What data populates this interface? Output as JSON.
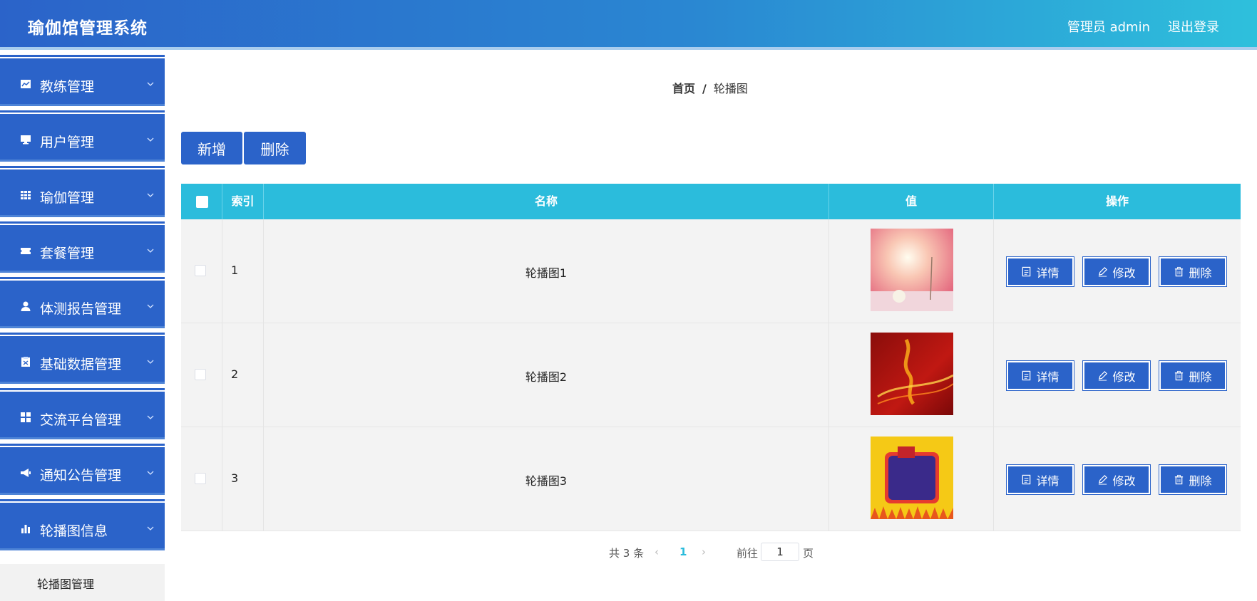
{
  "header": {
    "title": "瑜伽馆管理系统",
    "user": "管理员 admin",
    "logout": "退出登录"
  },
  "sidebar": {
    "items": [
      {
        "label": "教练管理",
        "icon": "chart-icon"
      },
      {
        "label": "用户管理",
        "icon": "monitor-icon"
      },
      {
        "label": "瑜伽管理",
        "icon": "grid-icon"
      },
      {
        "label": "套餐管理",
        "icon": "ticket-icon"
      },
      {
        "label": "体测报告管理",
        "icon": "user-icon"
      },
      {
        "label": "基础数据管理",
        "icon": "clipboard-icon"
      },
      {
        "label": "交流平台管理",
        "icon": "apps-icon"
      },
      {
        "label": "通知公告管理",
        "icon": "megaphone-icon"
      },
      {
        "label": "轮播图信息",
        "icon": "bar-chart-icon"
      }
    ],
    "submenu": {
      "label": "轮播图管理"
    }
  },
  "breadcrumb": {
    "home": "首页",
    "separator": "/",
    "current": "轮播图"
  },
  "toolbar": {
    "add_label": "新增",
    "delete_label": "删除"
  },
  "table": {
    "headers": {
      "index": "索引",
      "name": "名称",
      "value": "值",
      "actions": "操作"
    },
    "rows": [
      {
        "index": "1",
        "name": "轮播图1",
        "image": "pink-sunrise-image"
      },
      {
        "index": "2",
        "name": "轮播图2",
        "image": "red-flame-image"
      },
      {
        "index": "3",
        "name": "轮播图3",
        "image": "yellow-frame-image"
      }
    ],
    "actions": {
      "detail": "详情",
      "edit": "修改",
      "delete": "删除"
    }
  },
  "pagination": {
    "total": "共 3 条",
    "current_page": "1",
    "goto": "前往",
    "page_input": "1",
    "unit": "页"
  },
  "colors": {
    "primary": "#2b63c9",
    "header_cyan": "#2bbcdc",
    "row_bg": "#f3f3f3"
  }
}
